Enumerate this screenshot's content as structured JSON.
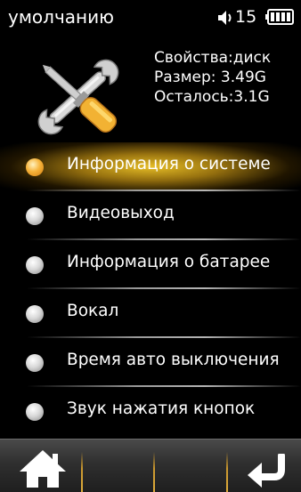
{
  "status_bar": {
    "title": "умолчанию",
    "volume": "15",
    "speaker_icon": "speaker-icon",
    "battery_icon": "battery-icon"
  },
  "storage": {
    "icon": "tools-icon",
    "properties": "Свойства:диск",
    "size": "Размер: 3.49G",
    "remaining": "Осталось:3.1G"
  },
  "menu": {
    "selected_index": 0,
    "items": [
      {
        "label": "Информация о системе"
      },
      {
        "label": "Видеовыход"
      },
      {
        "label": "Информация о батарее"
      },
      {
        "label": "Вокал"
      },
      {
        "label": "Время авто выключения"
      },
      {
        "label": "Звук нажатия кнопок"
      }
    ]
  },
  "bottom_bar": {
    "home_icon": "home-icon",
    "back_icon": "back-arrow-icon"
  },
  "colors": {
    "highlight": "#f3c828",
    "separator": "#c8962e",
    "background": "#000000"
  }
}
